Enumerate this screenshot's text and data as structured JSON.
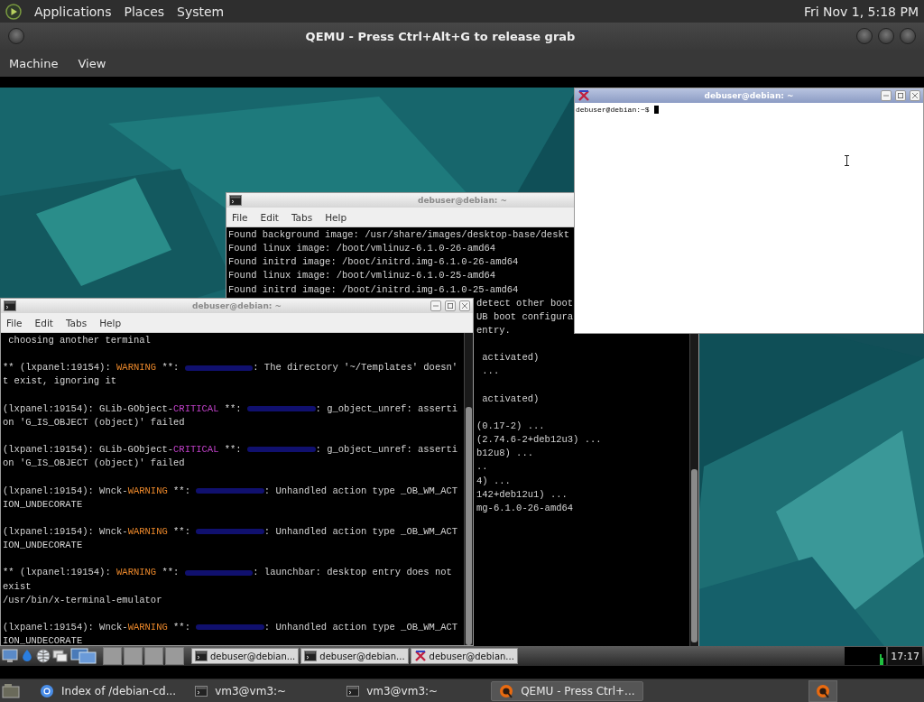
{
  "top_panel": {
    "menus": [
      "Applications",
      "Places",
      "System"
    ],
    "clock": "Fri Nov 1, 5:18 PM"
  },
  "qemu_window": {
    "title": "QEMU - Press Ctrl+Alt+G to release grab",
    "menus": [
      "Machine",
      "View"
    ]
  },
  "guest": {
    "terminal_back": {
      "title": "debuser@debian: ~",
      "menus": [
        "File",
        "Edit",
        "Tabs",
        "Help"
      ],
      "lines": [
        {
          "kind": "full",
          "text": "Found background image: /usr/share/images/desktop-base/deskt"
        },
        {
          "kind": "full",
          "text": "Found linux image: /boot/vmlinuz-6.1.0-26-amd64"
        },
        {
          "kind": "full",
          "text": "Found initrd image: /boot/initrd.img-6.1.0-26-amd64"
        },
        {
          "kind": "full",
          "text": "Found linux image: /boot/vmlinuz-6.1.0-25-amd64"
        },
        {
          "kind": "full",
          "text": "Found initrd image: /boot/initrd.img-6.1.0-25-amd64"
        },
        {
          "kind": "cut",
          "text": "detect other boot"
        },
        {
          "kind": "cut",
          "text": "UB boot configura"
        },
        {
          "kind": "cut",
          "text": "entry."
        },
        {
          "kind": "blank"
        },
        {
          "kind": "cut",
          "text": " activated)"
        },
        {
          "kind": "cut",
          "text": " ..."
        },
        {
          "kind": "blank"
        },
        {
          "kind": "cut",
          "text": " activated)"
        },
        {
          "kind": "blank"
        },
        {
          "kind": "cut",
          "text": "(0.17-2) ..."
        },
        {
          "kind": "cut",
          "text": "(2.74.6-2+deb12u3) ..."
        },
        {
          "kind": "cut",
          "text": "b12u8) ..."
        },
        {
          "kind": "cut",
          "text": ".."
        },
        {
          "kind": "cut",
          "text": "4) ..."
        },
        {
          "kind": "cut",
          "text": "142+deb12u1) ..."
        },
        {
          "kind": "cut",
          "text": "mg-6.1.0-26-amd64"
        }
      ]
    },
    "terminal_front": {
      "title": "debuser@debian: ~",
      "menus": [
        "File",
        "Edit",
        "Tabs",
        "Help"
      ],
      "lines": [
        {
          "kind": "text",
          "segments": [
            {
              "kind": "plain",
              "text": " choosing another terminal"
            }
          ]
        },
        {
          "kind": "blank"
        },
        {
          "kind": "text",
          "segments": [
            {
              "kind": "plain",
              "text": "** (lxpanel:19154): "
            },
            {
              "kind": "warning",
              "text": "WARNING"
            },
            {
              "kind": "plain",
              "text": " **: "
            },
            {
              "kind": "blurred"
            },
            {
              "kind": "plain",
              "text": ": The directory '~/Templates' doesn'"
            }
          ]
        },
        {
          "kind": "text",
          "segments": [
            {
              "kind": "plain",
              "text": "t exist, ignoring it"
            }
          ]
        },
        {
          "kind": "blank"
        },
        {
          "kind": "text",
          "segments": [
            {
              "kind": "plain",
              "text": "(lxpanel:19154): GLib-GObject-"
            },
            {
              "kind": "critical",
              "text": "CRITICAL"
            },
            {
              "kind": "plain",
              "text": " **: "
            },
            {
              "kind": "blurred"
            },
            {
              "kind": "plain",
              "text": ": g_object_unref: asserti"
            }
          ]
        },
        {
          "kind": "text",
          "segments": [
            {
              "kind": "plain",
              "text": "on 'G_IS_OBJECT (object)' failed"
            }
          ]
        },
        {
          "kind": "blank"
        },
        {
          "kind": "text",
          "segments": [
            {
              "kind": "plain",
              "text": "(lxpanel:19154): GLib-GObject-"
            },
            {
              "kind": "critical",
              "text": "CRITICAL"
            },
            {
              "kind": "plain",
              "text": " **: "
            },
            {
              "kind": "blurred"
            },
            {
              "kind": "plain",
              "text": ": g_object_unref: asserti"
            }
          ]
        },
        {
          "kind": "text",
          "segments": [
            {
              "kind": "plain",
              "text": "on 'G_IS_OBJECT (object)' failed"
            }
          ]
        },
        {
          "kind": "blank"
        },
        {
          "kind": "text",
          "segments": [
            {
              "kind": "plain",
              "text": "(lxpanel:19154): Wnck-"
            },
            {
              "kind": "warning",
              "text": "WARNING"
            },
            {
              "kind": "plain",
              "text": " **: "
            },
            {
              "kind": "blurred"
            },
            {
              "kind": "plain",
              "text": ": Unhandled action type _OB_WM_ACT"
            }
          ]
        },
        {
          "kind": "text",
          "segments": [
            {
              "kind": "plain",
              "text": "ION_UNDECORATE"
            }
          ]
        },
        {
          "kind": "blank"
        },
        {
          "kind": "text",
          "segments": [
            {
              "kind": "plain",
              "text": "(lxpanel:19154): Wnck-"
            },
            {
              "kind": "warning",
              "text": "WARNING"
            },
            {
              "kind": "plain",
              "text": " **: "
            },
            {
              "kind": "blurred"
            },
            {
              "kind": "plain",
              "text": ": Unhandled action type _OB_WM_ACT"
            }
          ]
        },
        {
          "kind": "text",
          "segments": [
            {
              "kind": "plain",
              "text": "ION_UNDECORATE"
            }
          ]
        },
        {
          "kind": "blank"
        },
        {
          "kind": "text",
          "segments": [
            {
              "kind": "plain",
              "text": "** (lxpanel:19154): "
            },
            {
              "kind": "warning",
              "text": "WARNING"
            },
            {
              "kind": "plain",
              "text": " **: "
            },
            {
              "kind": "blurred"
            },
            {
              "kind": "plain",
              "text": ": launchbar: desktop entry does not"
            }
          ]
        },
        {
          "kind": "text",
          "segments": [
            {
              "kind": "plain",
              "text": "exist"
            }
          ]
        },
        {
          "kind": "text",
          "segments": [
            {
              "kind": "plain",
              "text": "/usr/bin/x-terminal-emulator"
            }
          ]
        },
        {
          "kind": "blank"
        },
        {
          "kind": "text",
          "segments": [
            {
              "kind": "plain",
              "text": "(lxpanel:19154): Wnck-"
            },
            {
              "kind": "warning",
              "text": "WARNING"
            },
            {
              "kind": "plain",
              "text": " **: "
            },
            {
              "kind": "blurred"
            },
            {
              "kind": "plain",
              "text": ": Unhandled action type _OB_WM_ACT"
            }
          ]
        },
        {
          "kind": "text",
          "segments": [
            {
              "kind": "plain",
              "text": "ION_UNDECORATE"
            }
          ]
        }
      ]
    },
    "xterm": {
      "title": "debuser@debian: ~",
      "prompt": "debuser@debian:~$"
    },
    "taskbar": {
      "tasks": [
        {
          "label": "debuser@debian...",
          "kind": "terminal"
        },
        {
          "label": "debuser@debian...",
          "kind": "terminal"
        },
        {
          "label": "debuser@debian...",
          "kind": "xterm"
        }
      ],
      "clock": "17:17"
    }
  },
  "host_taskbar": {
    "tasks": [
      {
        "label": "Index of /debian-cd...",
        "kind": "browser",
        "selected": false
      },
      {
        "label": "vm3@vm3:~",
        "kind": "terminal",
        "selected": false
      },
      {
        "label": "vm3@vm3:~",
        "kind": "terminal",
        "selected": false
      },
      {
        "label": "QEMU - Press Ctrl+...",
        "kind": "qemu",
        "selected": true
      }
    ]
  }
}
